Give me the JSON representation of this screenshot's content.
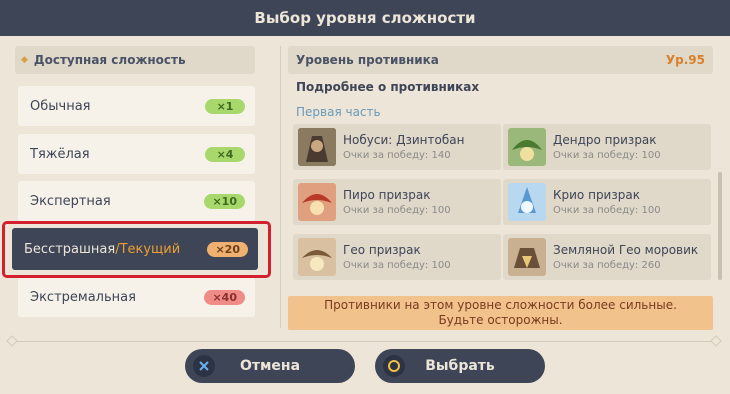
{
  "window": {
    "title": "Выбор уровня сложности"
  },
  "left": {
    "header": "Доступная сложность",
    "items": [
      {
        "label": "Обычная",
        "mult": "×1",
        "color": "green"
      },
      {
        "label": "Тяжёлая",
        "mult": "×4",
        "color": "green"
      },
      {
        "label": "Экспертная",
        "mult": "×10",
        "color": "green"
      },
      {
        "label": "Бесстрашная",
        "current": "/Текущий",
        "mult": "×20",
        "color": "orange",
        "selected": true
      },
      {
        "label": "Экстремальная",
        "mult": "×40",
        "color": "red"
      }
    ]
  },
  "right": {
    "enemy_level_label": "Уровень противника",
    "enemy_level_value": "Ур.95",
    "more_info": "Подробнее о противниках",
    "part": "Первая часть",
    "enemies": [
      {
        "name": "Нобуси: Дзинтобан",
        "pts": "Очки за победу: 140",
        "icon": "nobushi-icon",
        "tint": "#6a5a48"
      },
      {
        "name": "Дендро призрак",
        "pts": "Очки за победу: 100",
        "icon": "dendro-specter-icon",
        "tint": "#6aa050"
      },
      {
        "name": "Пиро призрак",
        "pts": "Очки за победу: 100",
        "icon": "pyro-specter-icon",
        "tint": "#c85838"
      },
      {
        "name": "Крио призрак",
        "pts": "Очки за победу: 100",
        "icon": "cryo-specter-icon",
        "tint": "#6aa8d8"
      },
      {
        "name": "Гео призрак",
        "pts": "Очки за победу: 100",
        "icon": "geo-specter-icon",
        "tint": "#a07850"
      },
      {
        "name": "Земляной Гео моровик",
        "pts": "Очки за победу: 260",
        "icon": "geovishap-icon",
        "tint": "#8a7050"
      }
    ],
    "warning": "Противники на этом уровне сложности более сильные. Будьте осторожны."
  },
  "footer": {
    "cancel": "Отмена",
    "select": "Выбрать"
  }
}
